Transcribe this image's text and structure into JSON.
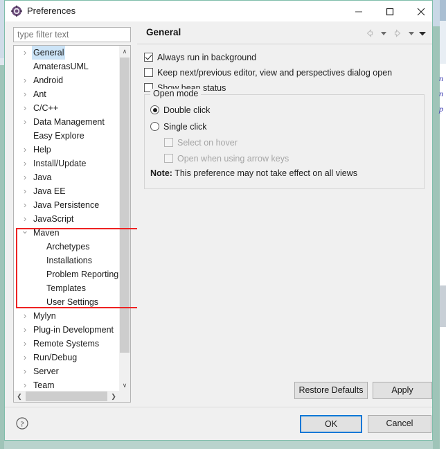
{
  "window": {
    "title": "Preferences",
    "icon": "preferences-gear-icon",
    "minimize_label": "—",
    "maximize_label": "□",
    "close_label": "✕"
  },
  "colors": {
    "selection": "#cce4f7",
    "focus_border": "#0078d7",
    "annotation": "#ee2222",
    "dialog_bg": "#f0f0f0",
    "backdrop": "#b9d3cd"
  },
  "filter": {
    "placeholder": "type filter text",
    "value": ""
  },
  "tree": {
    "items": [
      {
        "label": "General",
        "expandable": true,
        "expanded": false,
        "child": false,
        "selected": true
      },
      {
        "label": "AmaterasUML",
        "expandable": false,
        "expanded": false,
        "child": false,
        "selected": false
      },
      {
        "label": "Android",
        "expandable": true,
        "expanded": false,
        "child": false,
        "selected": false
      },
      {
        "label": "Ant",
        "expandable": true,
        "expanded": false,
        "child": false,
        "selected": false
      },
      {
        "label": "C/C++",
        "expandable": true,
        "expanded": false,
        "child": false,
        "selected": false
      },
      {
        "label": "Data Management",
        "expandable": true,
        "expanded": false,
        "child": false,
        "selected": false
      },
      {
        "label": "Easy Explore",
        "expandable": false,
        "expanded": false,
        "child": false,
        "selected": false
      },
      {
        "label": "Help",
        "expandable": true,
        "expanded": false,
        "child": false,
        "selected": false
      },
      {
        "label": "Install/Update",
        "expandable": true,
        "expanded": false,
        "child": false,
        "selected": false
      },
      {
        "label": "Java",
        "expandable": true,
        "expanded": false,
        "child": false,
        "selected": false
      },
      {
        "label": "Java EE",
        "expandable": true,
        "expanded": false,
        "child": false,
        "selected": false
      },
      {
        "label": "Java Persistence",
        "expandable": true,
        "expanded": false,
        "child": false,
        "selected": false
      },
      {
        "label": "JavaScript",
        "expandable": true,
        "expanded": false,
        "child": false,
        "selected": false
      },
      {
        "label": "Maven",
        "expandable": true,
        "expanded": true,
        "child": false,
        "selected": false
      },
      {
        "label": "Archetypes",
        "expandable": false,
        "expanded": false,
        "child": true,
        "selected": false
      },
      {
        "label": "Installations",
        "expandable": false,
        "expanded": false,
        "child": true,
        "selected": false
      },
      {
        "label": "Problem Reporting",
        "expandable": false,
        "expanded": false,
        "child": true,
        "selected": false
      },
      {
        "label": "Templates",
        "expandable": false,
        "expanded": false,
        "child": true,
        "selected": false
      },
      {
        "label": "User Settings",
        "expandable": false,
        "expanded": false,
        "child": true,
        "selected": false
      },
      {
        "label": "Mylyn",
        "expandable": true,
        "expanded": false,
        "child": false,
        "selected": false
      },
      {
        "label": "Plug-in Development",
        "expandable": true,
        "expanded": false,
        "child": false,
        "selected": false
      },
      {
        "label": "Remote Systems",
        "expandable": true,
        "expanded": false,
        "child": false,
        "selected": false
      },
      {
        "label": "Run/Debug",
        "expandable": true,
        "expanded": false,
        "child": false,
        "selected": false
      },
      {
        "label": "Server",
        "expandable": true,
        "expanded": false,
        "child": false,
        "selected": false
      },
      {
        "label": "Team",
        "expandable": true,
        "expanded": false,
        "child": false,
        "selected": false
      }
    ],
    "scroll_up_glyph": "∧",
    "scroll_down_glyph": "∨",
    "scroll_left_glyph": "❮",
    "scroll_right_glyph": "❯"
  },
  "content": {
    "title": "General",
    "nav": {
      "back": "back-arrow-icon",
      "back_dropdown": "chevron-down-icon",
      "forward": "forward-arrow-icon",
      "forward_dropdown": "chevron-down-icon",
      "menu": "view-menu-icon"
    },
    "checkboxes": [
      {
        "label": "Always run in background",
        "checked": true,
        "enabled": true
      },
      {
        "label": "Keep next/previous editor, view and perspectives dialog open",
        "checked": false,
        "enabled": true
      },
      {
        "label": "Show heap status",
        "checked": false,
        "enabled": true
      }
    ],
    "open_mode": {
      "legend": "Open mode",
      "radios": [
        {
          "label": "Double click",
          "checked": true
        },
        {
          "label": "Single click",
          "checked": false
        }
      ],
      "sub_checkboxes": [
        {
          "label": "Select on hover",
          "checked": false,
          "enabled": false
        },
        {
          "label": "Open when using arrow keys",
          "checked": false,
          "enabled": false
        }
      ],
      "note_prefix": "Note:",
      "note_text": "This preference may not take effect on all views"
    },
    "restore_defaults_label": "Restore Defaults",
    "apply_label": "Apply"
  },
  "footer": {
    "help_icon": "help-question-icon",
    "ok_label": "OK",
    "cancel_label": "Cancel"
  },
  "backdrop_text": {
    "fragments": [
      "n",
      "n",
      "p"
    ]
  }
}
